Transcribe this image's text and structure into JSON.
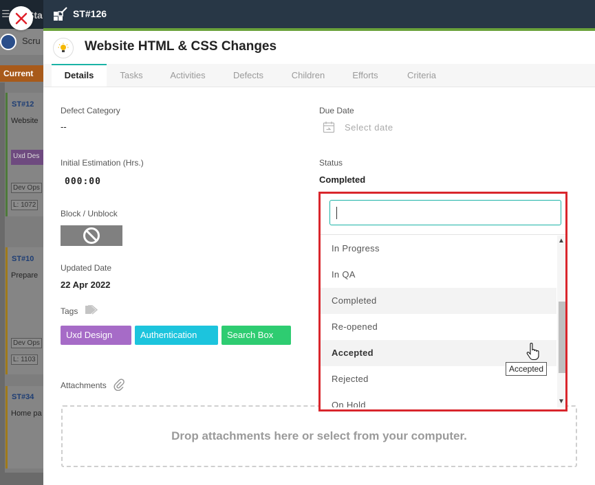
{
  "background": {
    "title": "Sta",
    "scrum_label": "Scru",
    "current_label": "Current",
    "cards": [
      {
        "id": "ST#12",
        "title": "Website",
        "tag": "Uxd Des",
        "chip1": "Dev Ops",
        "chip2": "L: 1072"
      },
      {
        "id": "ST#10",
        "title": "Prepare",
        "chip1": "Dev Ops",
        "chip2": "L: 1103"
      },
      {
        "id": "ST#34",
        "title": "Home pa"
      }
    ]
  },
  "panel": {
    "header_id": "ST#126",
    "title": "Website HTML & CSS Changes",
    "tabs": [
      "Details",
      "Tasks",
      "Activities",
      "Defects",
      "Children",
      "Efforts",
      "Criteria"
    ],
    "active_tab": "Details",
    "fields": {
      "defect_category_label": "Defect Category",
      "defect_category_value": "--",
      "due_date_label": "Due Date",
      "due_date_placeholder": "Select date",
      "initial_estimation_label": "Initial Estimation (Hrs.)",
      "initial_estimation_value": "000:00",
      "status_label": "Status",
      "status_value": "Completed",
      "block_label": "Block / Unblock",
      "updated_date_label": "Updated Date",
      "updated_date_value": "22 Apr 2022",
      "tags_label": "Tags",
      "attachments_label": "Attachments"
    },
    "tags": [
      {
        "label": "Uxd Design",
        "color": "#a66bc7"
      },
      {
        "label": "Authentication",
        "color": "#1cc4dd"
      },
      {
        "label": "Search Box",
        "color": "#2ecc71"
      }
    ],
    "dropzone_text": "Drop attachments here or select from your computer."
  },
  "status_dropdown": {
    "search_value": "",
    "options": [
      "In Progress",
      "In QA",
      "Completed",
      "Re-opened",
      "Accepted",
      "Rejected",
      "On Hold"
    ],
    "selected": "Completed",
    "hovered": "Accepted",
    "tooltip": "Accepted"
  },
  "colors": {
    "header": "#283746",
    "accent": "#1ab3a6",
    "green_line": "#6aa23a",
    "dropdown_border": "#d9262c"
  }
}
